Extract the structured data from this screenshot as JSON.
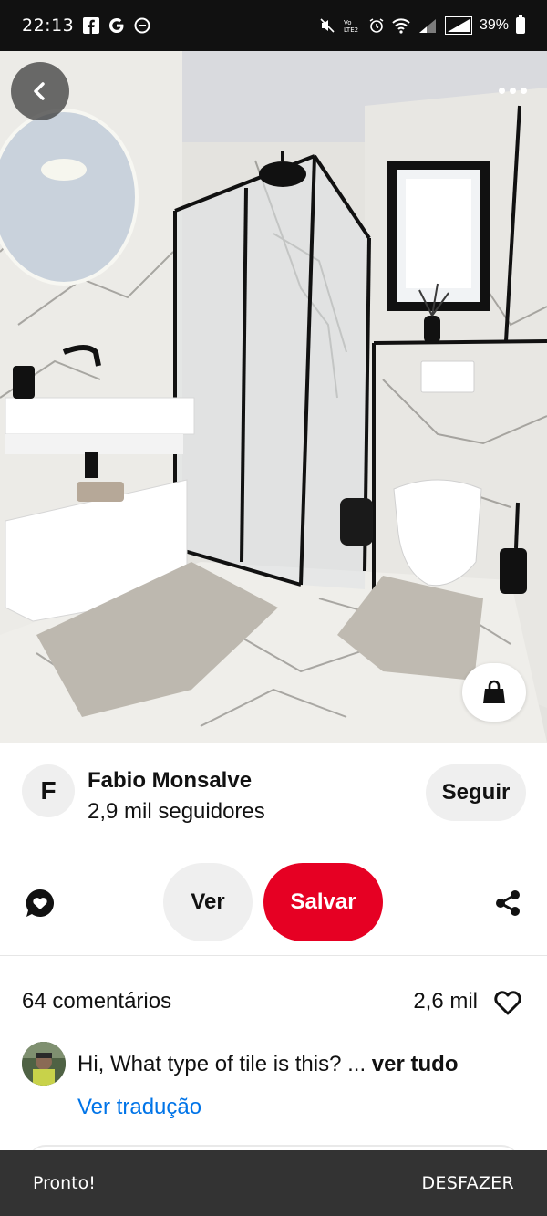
{
  "status_bar": {
    "time": "22:13",
    "battery_percent": "39%",
    "notification_icons": [
      "facebook-icon",
      "google-icon",
      "do-not-disturb-icon"
    ],
    "system_icons": [
      "mute-icon",
      "volte-icon",
      "alarm-icon",
      "wifi-icon",
      "signal-icon",
      "signal-icon",
      "battery-icon"
    ]
  },
  "pin": {
    "image_subject": "marble bathroom",
    "icons": {
      "back": "chevron-left-icon",
      "more": "more-horizontal-icon",
      "shop": "shopping-bag-icon"
    }
  },
  "creator": {
    "initial": "F",
    "name": "Fabio Monsalve",
    "followers": "2,9 mil seguidores",
    "follow_label": "Seguir"
  },
  "actions": {
    "comment_icon": "comment-icon",
    "view_label": "Ver",
    "save_label": "Salvar",
    "share_icon": "share-icon",
    "save_color": "#e60023"
  },
  "comments": {
    "count_label": "64 comentários",
    "likes_label": "2,6 mil",
    "heart_icon": "heart-outline-icon",
    "items": [
      {
        "text": "Hi, What type of tile is this? ...",
        "see_all": "ver tudo",
        "translate": "Ver tradução"
      }
    ]
  },
  "snackbar": {
    "message": "Pronto!",
    "action": "DESFAZER"
  },
  "colors": {
    "link": "#0074e8",
    "status_bar_bg": "#111111",
    "snackbar_bg": "#333333"
  }
}
